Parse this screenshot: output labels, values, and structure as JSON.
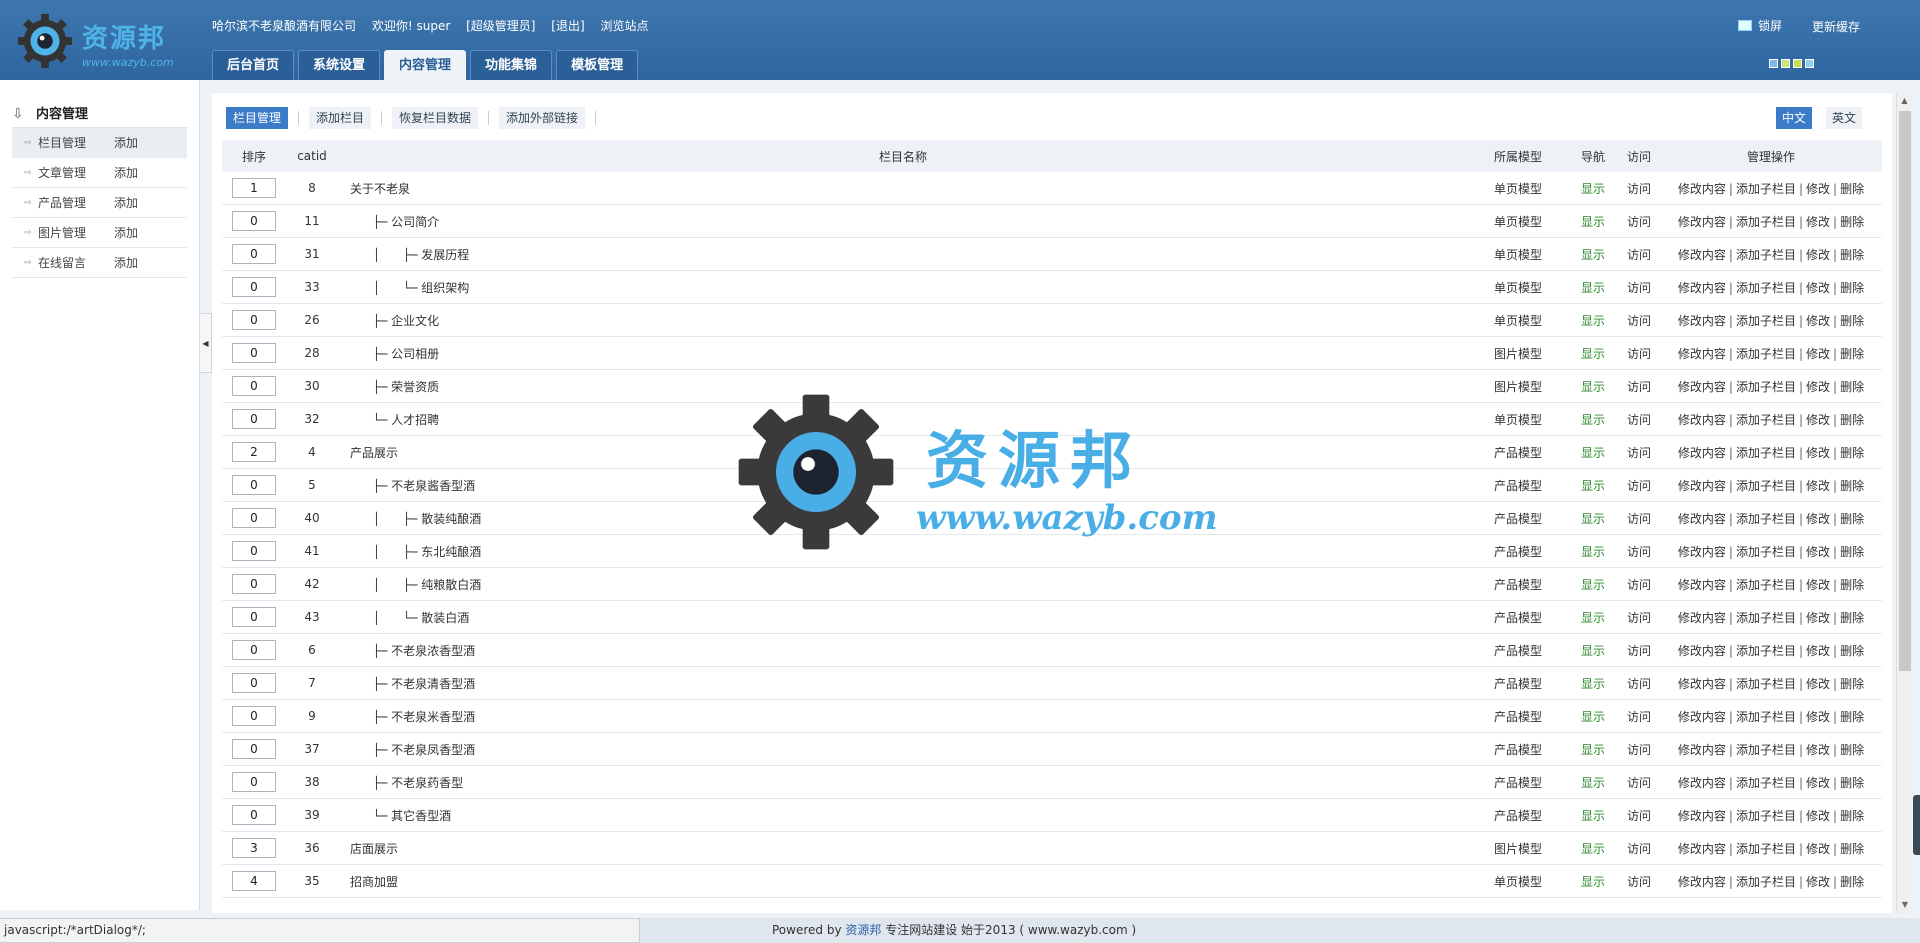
{
  "logo": {
    "text": "资源邦",
    "url": "www.wazyb.com"
  },
  "topbar": {
    "company": "哈尔滨不老泉酿酒有限公司",
    "welcome": "欢迎你! super",
    "role": "[超级管理员]",
    "logout": "[退出]",
    "browse": "浏览站点",
    "lock": "锁屏",
    "refresh_cache": "更新缓存",
    "theme_colors": [
      "#7fb8e6",
      "#cfe27a",
      "#c9df4e",
      "#8fd0ee"
    ]
  },
  "nav_tabs": [
    {
      "label": "后台首页",
      "active": false
    },
    {
      "label": "系统设置",
      "active": false
    },
    {
      "label": "内容管理",
      "active": true
    },
    {
      "label": "功能集锦",
      "active": false
    },
    {
      "label": "模板管理",
      "active": false
    }
  ],
  "sidebar": {
    "title": "内容管理",
    "items": [
      {
        "label": "栏目管理",
        "add": "添加",
        "active": true
      },
      {
        "label": "文章管理",
        "add": "添加",
        "active": false
      },
      {
        "label": "产品管理",
        "add": "添加",
        "active": false
      },
      {
        "label": "图片管理",
        "add": "添加",
        "active": false
      },
      {
        "label": "在线留言",
        "add": "添加",
        "active": false
      }
    ]
  },
  "toolbar": {
    "buttons": [
      {
        "label": "栏目管理",
        "active": true
      },
      {
        "label": "添加栏目",
        "active": false
      },
      {
        "label": "恢复栏目数据",
        "active": false
      },
      {
        "label": "添加外部链接",
        "active": false
      }
    ]
  },
  "lang": {
    "zh": "中文",
    "en": "英文"
  },
  "table": {
    "headers": {
      "sort": "排序",
      "catid": "catid",
      "name": "栏目名称",
      "model": "所属模型",
      "nav": "导航",
      "visit": "访问",
      "ops": "管理操作"
    },
    "ops": {
      "edit_content": "修改内容",
      "add_child": "添加子栏目",
      "edit": "修改",
      "delete": "删除",
      "sep": "|"
    },
    "rows": [
      {
        "sort": "1",
        "catid": "8",
        "name": "关于不老泉",
        "model": "单页模型",
        "nav": "显示",
        "visit": "访问"
      },
      {
        "sort": "0",
        "catid": "11",
        "name": "      ├─ 公司简介",
        "model": "单页模型",
        "nav": "显示",
        "visit": "访问"
      },
      {
        "sort": "0",
        "catid": "31",
        "name": "      │      ├─ 发展历程",
        "model": "单页模型",
        "nav": "显示",
        "visit": "访问"
      },
      {
        "sort": "0",
        "catid": "33",
        "name": "      │      └─ 组织架构",
        "model": "单页模型",
        "nav": "显示",
        "visit": "访问"
      },
      {
        "sort": "0",
        "catid": "26",
        "name": "      ├─ 企业文化",
        "model": "单页模型",
        "nav": "显示",
        "visit": "访问"
      },
      {
        "sort": "0",
        "catid": "28",
        "name": "      ├─ 公司相册",
        "model": "图片模型",
        "nav": "显示",
        "visit": "访问"
      },
      {
        "sort": "0",
        "catid": "30",
        "name": "      ├─ 荣誉资质",
        "model": "图片模型",
        "nav": "显示",
        "visit": "访问"
      },
      {
        "sort": "0",
        "catid": "32",
        "name": "      └─ 人才招聘",
        "model": "单页模型",
        "nav": "显示",
        "visit": "访问"
      },
      {
        "sort": "2",
        "catid": "4",
        "name": "产品展示",
        "model": "产品模型",
        "nav": "显示",
        "visit": "访问"
      },
      {
        "sort": "0",
        "catid": "5",
        "name": "      ├─ 不老泉酱香型酒",
        "model": "产品模型",
        "nav": "显示",
        "visit": "访问"
      },
      {
        "sort": "0",
        "catid": "40",
        "name": "      │      ├─ 散装纯酿酒",
        "model": "产品模型",
        "nav": "显示",
        "visit": "访问"
      },
      {
        "sort": "0",
        "catid": "41",
        "name": "      │      ├─ 东北纯酿酒",
        "model": "产品模型",
        "nav": "显示",
        "visit": "访问"
      },
      {
        "sort": "0",
        "catid": "42",
        "name": "      │      ├─ 纯粮散白酒",
        "model": "产品模型",
        "nav": "显示",
        "visit": "访问"
      },
      {
        "sort": "0",
        "catid": "43",
        "name": "      │      └─ 散装白酒",
        "model": "产品模型",
        "nav": "显示",
        "visit": "访问"
      },
      {
        "sort": "0",
        "catid": "6",
        "name": "      ├─ 不老泉浓香型酒",
        "model": "产品模型",
        "nav": "显示",
        "visit": "访问"
      },
      {
        "sort": "0",
        "catid": "7",
        "name": "      ├─ 不老泉清香型酒",
        "model": "产品模型",
        "nav": "显示",
        "visit": "访问"
      },
      {
        "sort": "0",
        "catid": "9",
        "name": "      ├─ 不老泉米香型酒",
        "model": "产品模型",
        "nav": "显示",
        "visit": "访问"
      },
      {
        "sort": "0",
        "catid": "37",
        "name": "      ├─ 不老泉凤香型酒",
        "model": "产品模型",
        "nav": "显示",
        "visit": "访问"
      },
      {
        "sort": "0",
        "catid": "38",
        "name": "      ├─ 不老泉药香型",
        "model": "产品模型",
        "nav": "显示",
        "visit": "访问"
      },
      {
        "sort": "0",
        "catid": "39",
        "name": "      └─ 其它香型酒",
        "model": "产品模型",
        "nav": "显示",
        "visit": "访问"
      },
      {
        "sort": "3",
        "catid": "36",
        "name": "店面展示",
        "model": "图片模型",
        "nav": "显示",
        "visit": "访问"
      },
      {
        "sort": "4",
        "catid": "35",
        "name": "招商加盟",
        "model": "单页模型",
        "nav": "显示",
        "visit": "访问"
      }
    ]
  },
  "watermark": {
    "text": "资源邦",
    "url": "www.wazyb.com"
  },
  "statusbar": {
    "text": "javascript:/*artDialog*/;"
  },
  "footer": {
    "powered_by": "Powered by",
    "brand": "资源邦",
    "desc": "专注网站建设 始于2013 ( www.wazyb.com )"
  }
}
